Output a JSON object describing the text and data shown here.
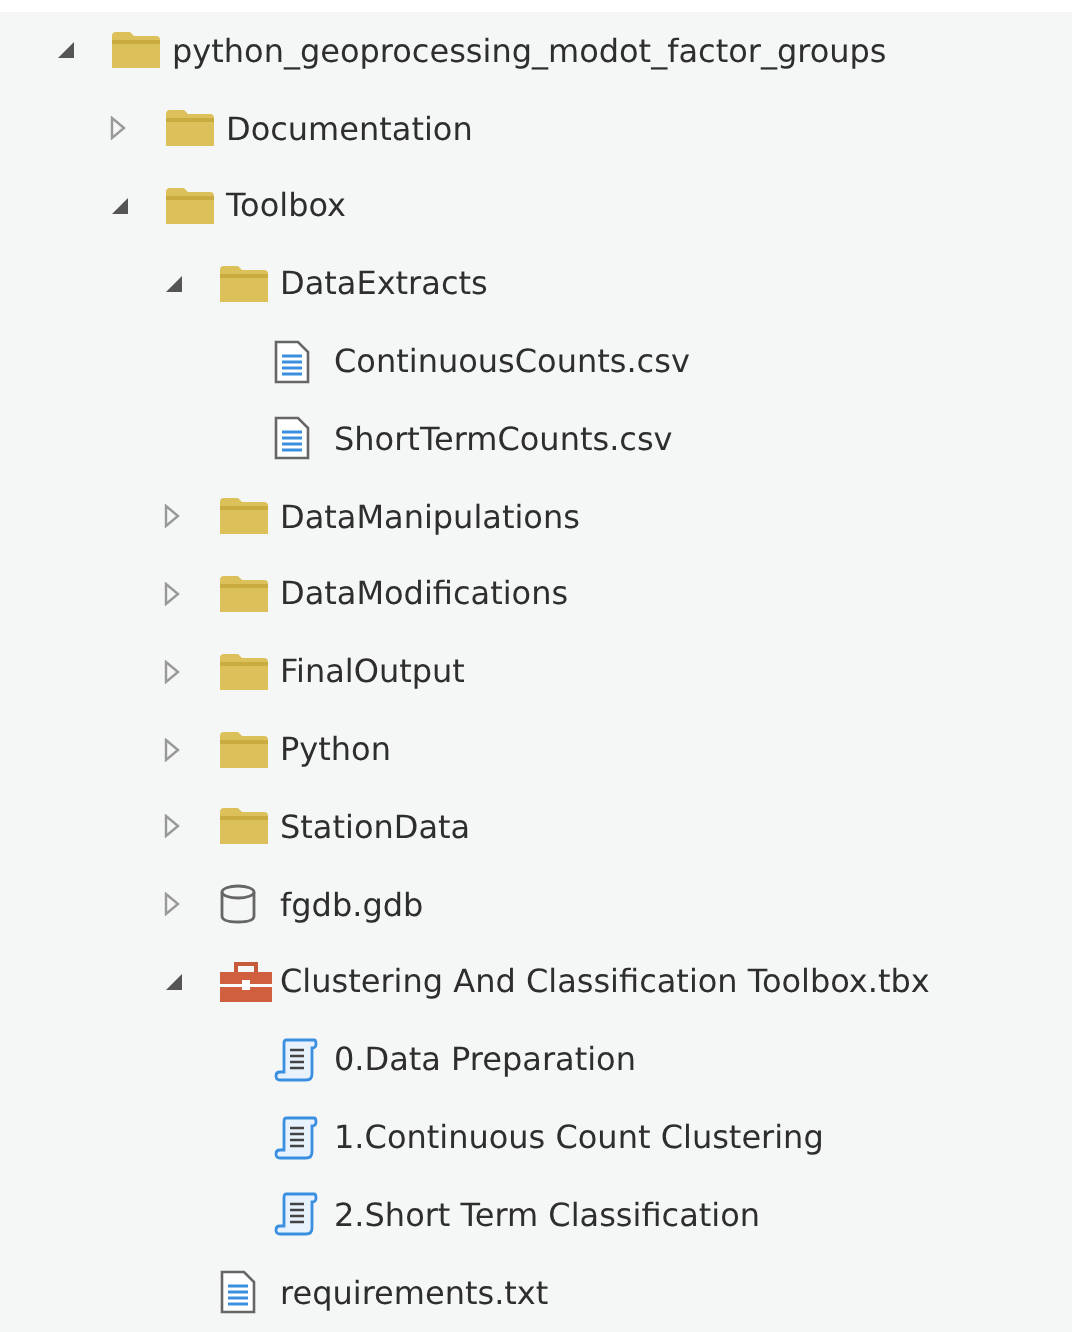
{
  "tree": [
    {
      "label": "python_geoprocessing_modot_factor_groups",
      "kind": "folder",
      "expanded": true,
      "children": [
        {
          "label": "Documentation",
          "kind": "folder",
          "expanded": false
        },
        {
          "label": "Toolbox",
          "kind": "folder",
          "expanded": true,
          "children": [
            {
              "label": "DataExtracts",
              "kind": "folder",
              "expanded": true,
              "children": [
                {
                  "label": "ContinuousCounts.csv",
                  "kind": "file"
                },
                {
                  "label": "ShortTermCounts.csv",
                  "kind": "file"
                }
              ]
            },
            {
              "label": "DataManipulations",
              "kind": "folder",
              "expanded": false
            },
            {
              "label": "DataModifications",
              "kind": "folder",
              "expanded": false
            },
            {
              "label": "FinalOutput",
              "kind": "folder",
              "expanded": false
            },
            {
              "label": "Python",
              "kind": "folder",
              "expanded": false
            },
            {
              "label": "StationData",
              "kind": "folder",
              "expanded": false
            },
            {
              "label": "fgdb.gdb",
              "kind": "database",
              "expanded": false
            },
            {
              "label": "Clustering And Classification Toolbox.tbx",
              "kind": "toolbox",
              "expanded": true,
              "children": [
                {
                  "label": "0.Data Preparation",
                  "kind": "script"
                },
                {
                  "label": "1.Continuous Count Clustering",
                  "kind": "script"
                },
                {
                  "label": "2.Short Term Classification",
                  "kind": "script"
                }
              ]
            },
            {
              "label": "requirements.txt",
              "kind": "file"
            }
          ]
        }
      ]
    }
  ]
}
